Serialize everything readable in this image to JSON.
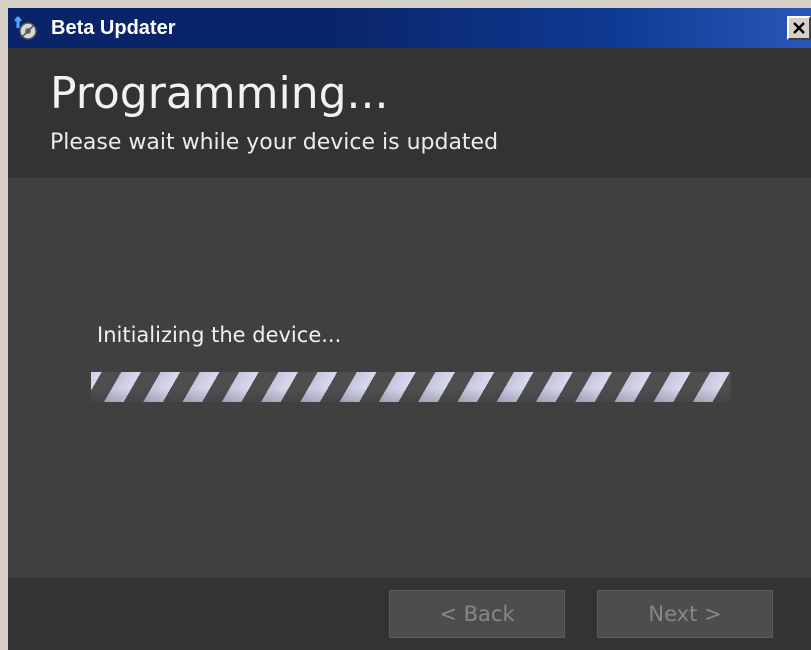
{
  "window": {
    "title": "Beta Updater",
    "icons": {
      "app": "updater-app-icon",
      "close": "close-icon"
    }
  },
  "header": {
    "title": "Programming...",
    "subtitle": "Please wait while your device is updated"
  },
  "content": {
    "status": "Initializing the device...",
    "progress": {
      "mode": "indeterminate",
      "stripe_color": "#d9d9ee",
      "track_color": "#4e4e4e"
    }
  },
  "footer": {
    "back_label": "< Back",
    "next_label": "Next >"
  },
  "colors": {
    "titlebar": "#0a246a",
    "header_bg": "#333333",
    "content_bg": "#404040",
    "button_text_disabled": "#878787"
  }
}
